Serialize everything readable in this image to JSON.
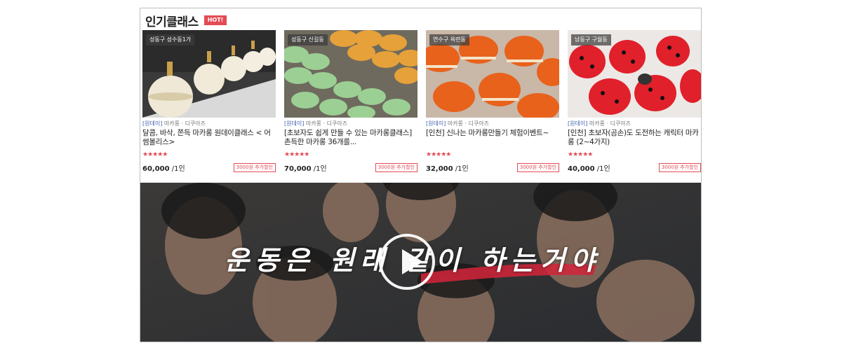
{
  "section": {
    "title": "인기클래스",
    "badge": "HOT!"
  },
  "cards": [
    {
      "location": "성동구 성수동1가",
      "tag": "[원데이]",
      "category": " 마카롱 · 디쿠아즈",
      "title": "달콤, 바삭, 쫀득 마카롱 원데이클래스 < 어썸볼리스>",
      "rating_stars": 5,
      "stars_text": "★★★★★",
      "price": "60,000",
      "unit": " /1인",
      "discount": "3000원 추가할인"
    },
    {
      "location": "성동구 신길동",
      "tag": "[원데이]",
      "category": " 마카롱 · 디쿠아즈",
      "title": "[초보자도 쉽게 만들 수 있는 마카롱클래스]촌득한 마카롱 36개를...",
      "rating_stars": 5,
      "stars_text": "★★★★★",
      "price": "70,000",
      "unit": " /1인",
      "discount": "3000원 추가할인"
    },
    {
      "location": "연수구 옥련동",
      "tag": "[원데이]",
      "category": " 마카롱 · 디쿠아즈",
      "title": "[인천] 신나는 마카롱만들기 체험이벤트~",
      "rating_stars": 5,
      "stars_text": "★★★★★",
      "price": "32,000",
      "unit": " /1인",
      "discount": "3000원 추가할인"
    },
    {
      "location": "남동구 구월동",
      "tag": "[원데이]",
      "category": " 마카롱 · 디쿠아즈",
      "title": "[인천] 초보자(곰손)도 도전하는 캐릭터 마카롱 (2~4가지)",
      "rating_stars": 5,
      "stars_text": "★★★★★",
      "price": "40,000",
      "unit": " /1인",
      "discount": "3000원 추가할인"
    }
  ],
  "video": {
    "slogan": "운동은 원래 같이 하는거야"
  },
  "colors": {
    "accent": "#e34b55",
    "link": "#3f5fae",
    "border": "#bdbdbd"
  }
}
